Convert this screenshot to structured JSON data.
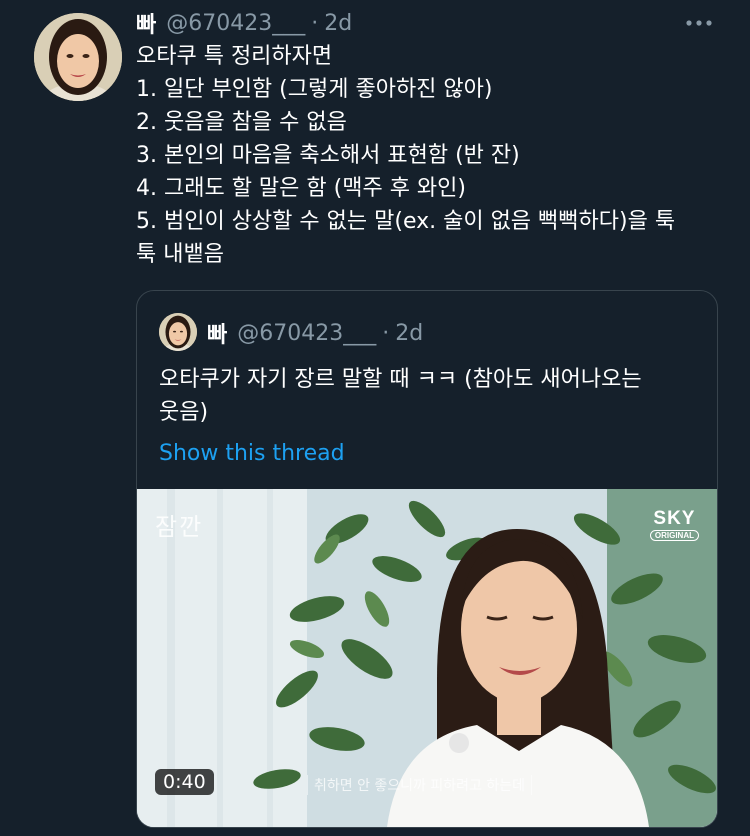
{
  "tweet": {
    "display_name": "빠",
    "handle": "@670423___",
    "separator": "·",
    "time": "2d",
    "more_icon": "more-horizontal-icon",
    "lines": [
      "오타쿠 특 정리하자면",
      "1. 일단 부인함 (그렇게 좋아하진 않아)",
      "2. 웃음을 참을 수 없음",
      "3. 본인의 마음을 축소해서 표현함 (반 잔)",
      "4. 그래도 할 말은 함 (맥주 후 와인)",
      "5. 범인이 상상할 수 없는 말(ex. 술이 없음 뻑뻑하다)을 툭",
      "툭 내뱉음"
    ]
  },
  "quoted_tweet": {
    "display_name": "빠",
    "handle": "@670423___",
    "separator": "·",
    "time": "2d",
    "text_lines": [
      "오타쿠가 자기 장르 말할 때 ㅋㅋ (참아도 새어나오는",
      "웃음)"
    ],
    "show_thread_label": "Show this thread",
    "media": {
      "overlay_text": "잠깐",
      "brand_word": "SKY",
      "brand_sub": "ORIGINAL",
      "duration": "0:40",
      "subtitle": "취하면 안 좋으니까 피하려고 하는데"
    }
  },
  "colors": {
    "background": "#15202b",
    "secondary_text": "#8899a6",
    "link": "#1da1f2",
    "border": "#38444d"
  }
}
